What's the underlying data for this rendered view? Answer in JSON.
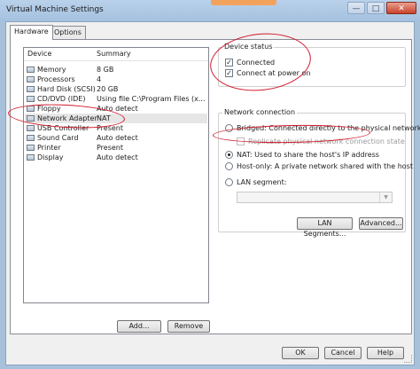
{
  "window": {
    "title": "Virtual Machine Settings",
    "minimize_glyph": "—",
    "maximize_glyph": "□",
    "close_glyph": "✕"
  },
  "tabs": [
    {
      "label": "Hardware"
    },
    {
      "label": "Options"
    }
  ],
  "device_list": {
    "headers": {
      "device": "Device",
      "summary": "Summary"
    },
    "rows": [
      {
        "device": "Memory",
        "summary": "8 GB",
        "icon": "memory-icon"
      },
      {
        "device": "Processors",
        "summary": "4",
        "icon": "processor-icon"
      },
      {
        "device": "Hard Disk (SCSI)",
        "summary": "20 GB",
        "icon": "hard-disk-icon"
      },
      {
        "device": "CD/DVD (IDE)",
        "summary": "Using file C:\\Program Files (x...",
        "icon": "cd-dvd-icon"
      },
      {
        "device": "Floppy",
        "summary": "Auto detect",
        "icon": "floppy-icon"
      },
      {
        "device": "Network Adapter",
        "summary": "NAT",
        "icon": "network-adapter-icon"
      },
      {
        "device": "USB Controller",
        "summary": "Present",
        "icon": "usb-icon"
      },
      {
        "device": "Sound Card",
        "summary": "Auto detect",
        "icon": "sound-card-icon"
      },
      {
        "device": "Printer",
        "summary": "Present",
        "icon": "printer-icon"
      },
      {
        "device": "Display",
        "summary": "Auto detect",
        "icon": "display-icon"
      }
    ],
    "selected": "Network Adapter"
  },
  "device_status": {
    "legend": "Device status",
    "connected": {
      "label": "Connected",
      "checked": true
    },
    "connect_at_power_on": {
      "label": "Connect at power on",
      "checked": true
    }
  },
  "network_connection": {
    "legend": "Network connection",
    "bridged": {
      "label": "Bridged: Connected directly to the physical network",
      "selected": false
    },
    "replicate": {
      "label": "Replicate physical network connection state",
      "enabled": false
    },
    "nat": {
      "label": "NAT: Used to share the host's IP address",
      "selected": true
    },
    "host_only": {
      "label": "Host-only: A private network shared with the host",
      "selected": false
    },
    "lan_segment": {
      "label": "LAN segment:",
      "selected": false,
      "value": ""
    }
  },
  "buttons": {
    "lan_segments": "LAN Segments...",
    "advanced": "Advanced...",
    "add": "Add...",
    "remove": "Remove",
    "ok": "OK",
    "cancel": "Cancel",
    "help": "Help"
  },
  "check_glyph": "✓",
  "colors": {
    "annotation": "#d2192c",
    "titlebar": "#a5c1df",
    "close_button": "#c9432b"
  }
}
